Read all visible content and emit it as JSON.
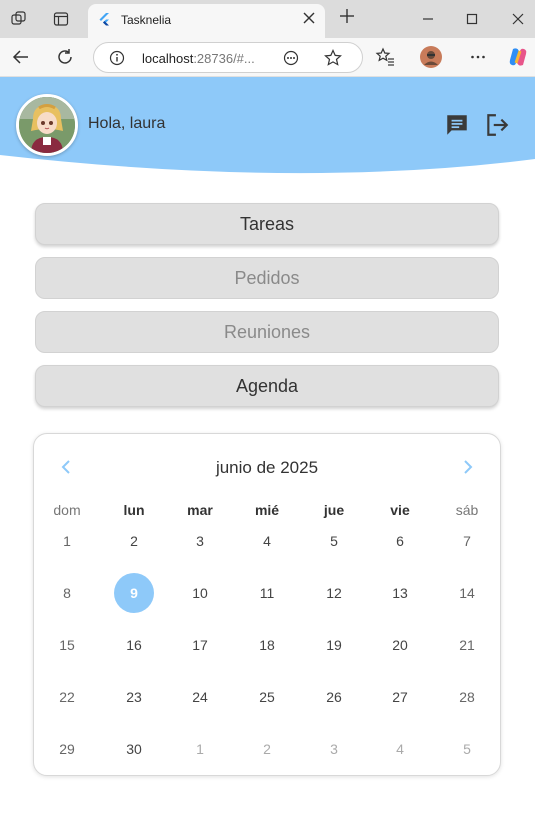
{
  "browser": {
    "tab_title": "Tasknelia",
    "url_host": "localhost",
    "url_rest": ":28736/#...",
    "icons": [
      "workspaces-icon",
      "tab-actions-icon",
      "flutter-favicon",
      "close-icon",
      "new-tab-icon",
      "minimize-icon",
      "maximize-icon",
      "window-close-icon",
      "back-icon",
      "reload-icon",
      "site-info-icon",
      "more-icon",
      "favorite-icon",
      "favorites-list-icon",
      "profile-icon",
      "settings-more-icon",
      "copilot-icon"
    ]
  },
  "colors": {
    "header": "#8ec9f9",
    "selected_day": "#8ec9f9",
    "nav_arrow": "#8ec9f9",
    "button_bg": "#e0e0e0"
  },
  "header": {
    "greeting": "Hola, laura",
    "icons": [
      "chat-icon",
      "logout-icon"
    ]
  },
  "menu": [
    {
      "label": "Tareas",
      "style": "raised"
    },
    {
      "label": "Pedidos",
      "style": "flat"
    },
    {
      "label": "Reuniones",
      "style": "flat"
    },
    {
      "label": "Agenda",
      "style": "raised"
    }
  ],
  "calendar": {
    "month_label": "junio de 2025",
    "weekdays": [
      "dom",
      "lun",
      "mar",
      "mié",
      "jue",
      "vie",
      "sáb"
    ],
    "selected_day": 9,
    "weeks": [
      [
        "1",
        "2",
        "3",
        "4",
        "5",
        "6",
        "7"
      ],
      [
        "8",
        "9",
        "10",
        "11",
        "12",
        "13",
        "14"
      ],
      [
        "15",
        "16",
        "17",
        "18",
        "19",
        "20",
        "21"
      ],
      [
        "22",
        "23",
        "24",
        "25",
        "26",
        "27",
        "28"
      ],
      [
        "29",
        "30",
        "1",
        "2",
        "3",
        "4",
        "5"
      ]
    ]
  }
}
